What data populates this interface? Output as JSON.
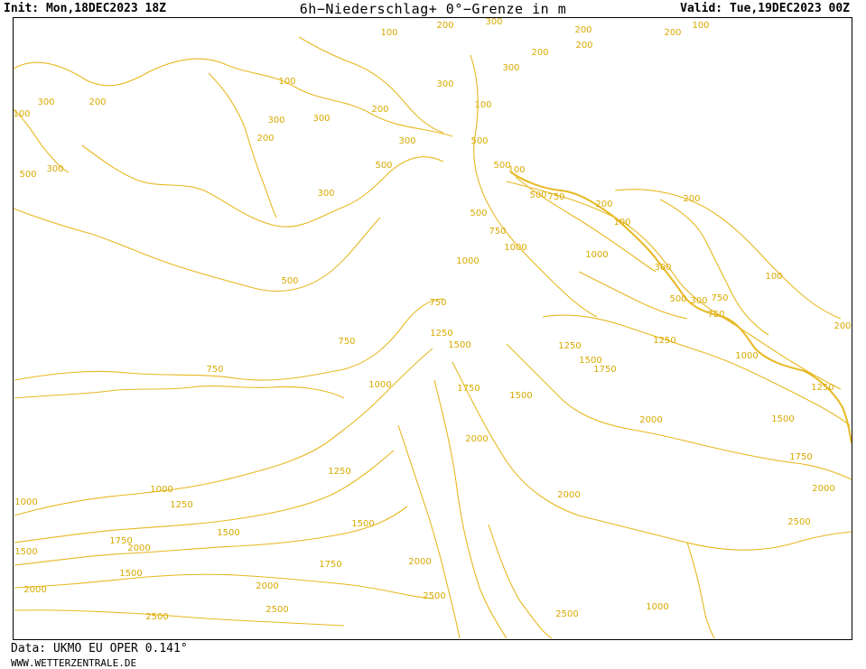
{
  "header": {
    "init": "Init: Mon,18DEC2023 18Z",
    "title": "6h−Niederschlag+ 0°−Grenze in m",
    "valid": "Valid: Tue,19DEC2023 00Z"
  },
  "footer": {
    "source": "Data: UKMO EU OPER 0.141°",
    "site": "WWW.WETTERZENTRALE.DE"
  },
  "map": {
    "contour_color": "#e7b820",
    "contour_levels": [
      "100",
      "200",
      "300",
      "500",
      "750",
      "1000",
      "1250",
      "1500",
      "1750",
      "2000",
      "2500"
    ],
    "labels": [
      "100",
      "200",
      "300",
      "200",
      "200",
      "100",
      "200",
      "300",
      "100",
      "100",
      "100",
      "200",
      "200",
      "300",
      "300",
      "200",
      "300",
      "300",
      "200",
      "300",
      "500",
      "500",
      "500",
      "300",
      "500",
      "500",
      "100",
      "500",
      "750",
      "200",
      "200",
      "100",
      "100",
      "300",
      "500",
      "300",
      "750",
      "300",
      "1000",
      "750",
      "1000",
      "1000",
      "500",
      "750",
      "750",
      "1250",
      "1500",
      "1250",
      "1000",
      "1250",
      "750",
      "1000",
      "750",
      "1500",
      "1750",
      "1750",
      "1500",
      "2000",
      "1500",
      "1250",
      "1500",
      "2000",
      "1750",
      "2000",
      "1250",
      "1000",
      "1250",
      "1000",
      "1500",
      "1500",
      "2000",
      "1500",
      "1750",
      "2000",
      "2500",
      "2000",
      "1750",
      "2000",
      "2500",
      "2000",
      "2500",
      "2500",
      "2500",
      "1000",
      "200"
    ]
  }
}
